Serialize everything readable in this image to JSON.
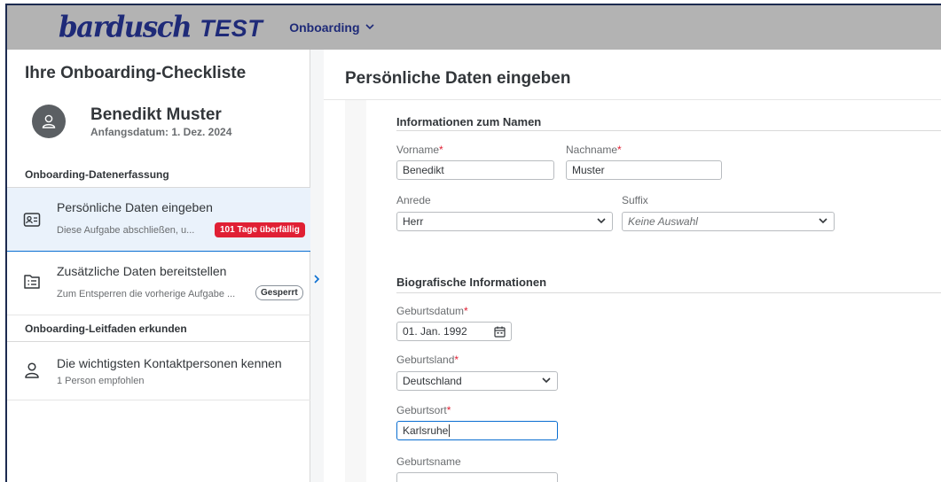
{
  "shell": {
    "brand": "bardusch",
    "brand_suffix": "TEST",
    "menu_label": "Onboarding"
  },
  "left": {
    "title": "Ihre Onboarding-Checkliste",
    "profile": {
      "name": "Benedikt Muster",
      "start_date": "Anfangsdatum: 1. Dez. 2024"
    },
    "sections": [
      {
        "label": "Onboarding-Datenerfassung"
      },
      {
        "label": "Onboarding-Leitfaden erkunden"
      }
    ],
    "tasks": [
      {
        "title": "Persönliche Daten eingeben",
        "subtitle": "Diese Aufgabe abschließen, u...",
        "badge": "101 Tage überfällig",
        "icon": "id-card-icon",
        "active": true
      },
      {
        "title": "Zusätzliche Daten bereitstellen",
        "subtitle": "Zum Entsperren die vorherige Aufgabe ...",
        "badge": "Gesperrt",
        "icon": "form-list-icon",
        "active": false
      },
      {
        "title": "Die wichtigsten Kontaktpersonen kennen",
        "subtitle": "1 Person empfohlen",
        "icon": "person-icon",
        "active": false
      }
    ]
  },
  "main": {
    "title": "Persönliche Daten eingeben",
    "groups": [
      {
        "title": "Informationen zum Namen"
      },
      {
        "title": "Biografische Informationen"
      }
    ],
    "fields": {
      "vorname": {
        "label": "Vorname",
        "value": "Benedikt",
        "required": true
      },
      "nachname": {
        "label": "Nachname",
        "value": "Muster",
        "required": true
      },
      "anrede": {
        "label": "Anrede",
        "value": "Herr"
      },
      "suffix": {
        "label": "Suffix",
        "placeholder": "Keine Auswahl"
      },
      "geburtsdatum": {
        "label": "Geburtsdatum",
        "value": "01. Jan. 1992",
        "required": true
      },
      "geburtsland": {
        "label": "Geburtsland",
        "value": "Deutschland",
        "required": true
      },
      "geburtsort": {
        "label": "Geburtsort",
        "value": "Karlsruhe",
        "required": true
      },
      "geburtsname": {
        "label": "Geburtsname",
        "value": ""
      }
    },
    "required_marker": "*"
  },
  "colors": {
    "brand": "#1e2a78",
    "accent": "#0a6ed1",
    "overdue": "#e02034",
    "shell_bg": "#b3b3b3"
  }
}
